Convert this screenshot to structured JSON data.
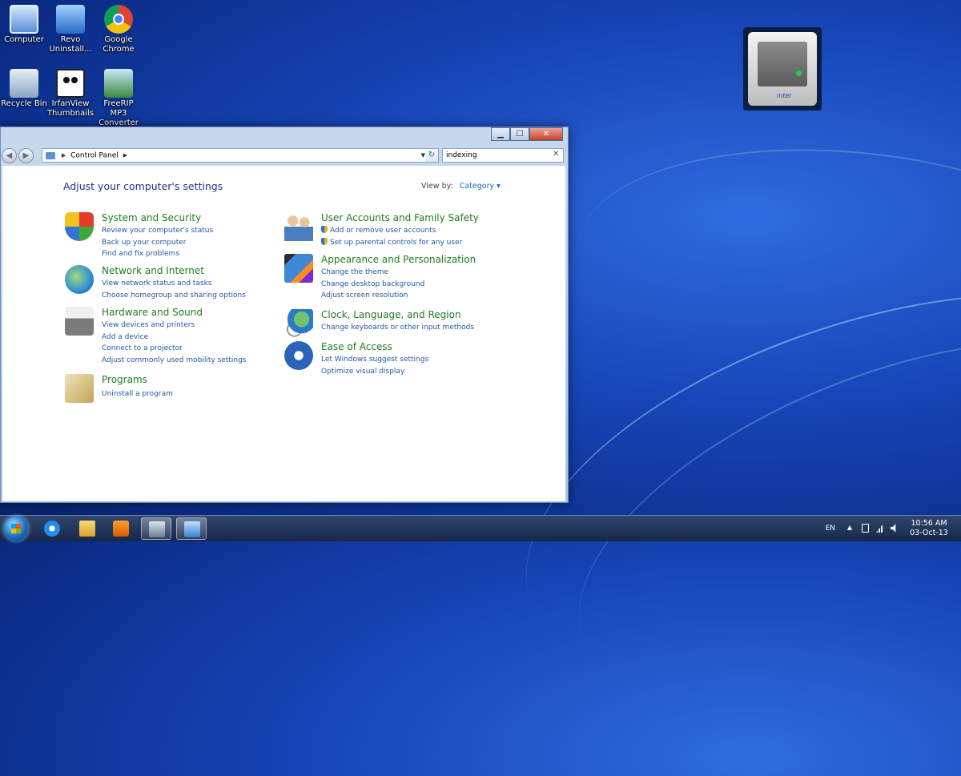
{
  "desktop": {
    "icons": [
      {
        "label": "Computer"
      },
      {
        "label": "Revo Uninstall..."
      },
      {
        "label": "Google Chrome"
      },
      {
        "label": "Recycle Bin"
      },
      {
        "label": "IrfanView Thumbnails"
      },
      {
        "label": "FreeRIP MP3 Converter"
      }
    ],
    "gadget": {
      "brand": "intel"
    }
  },
  "window": {
    "caption_buttons": {
      "minimize": "▁",
      "maximize": "☐",
      "close": "✕"
    },
    "nav": {
      "back": "◀",
      "forward": "▶"
    },
    "address": {
      "crumb": "Control Panel",
      "separator": "▶",
      "dropdown": "▼",
      "refresh": "↻"
    },
    "search": {
      "value": "indexing",
      "clear": "✕"
    },
    "title": "Adjust your computer's settings",
    "view_by": {
      "label": "View by:",
      "value": "Category ▾"
    },
    "categories_left": [
      {
        "title": "System and Security",
        "links": [
          "Review your computer's status",
          "Back up your computer",
          "Find and fix problems"
        ]
      },
      {
        "title": "Network and Internet",
        "links": [
          "View network status and tasks",
          "Choose homegroup and sharing options"
        ]
      },
      {
        "title": "Hardware and Sound",
        "links": [
          "View devices and printers",
          "Add a device",
          "Connect to a projector",
          "Adjust commonly used mobility settings"
        ]
      },
      {
        "title": "Programs",
        "links": [
          "Uninstall a program"
        ]
      }
    ],
    "categories_right": [
      {
        "title": "User Accounts and Family Safety",
        "links": [
          "Add or remove user accounts",
          "Set up parental controls for any user"
        ]
      },
      {
        "title": "Appearance and Personalization",
        "links": [
          "Change the theme",
          "Change desktop background",
          "Adjust screen resolution"
        ]
      },
      {
        "title": "Clock, Language, and Region",
        "links": [
          "Change keyboards or other input methods"
        ]
      },
      {
        "title": "Ease of Access",
        "links": [
          "Let Windows suggest settings",
          "Optimize visual display"
        ]
      }
    ]
  },
  "taskbar": {
    "language": "EN",
    "tray_expand": "▲",
    "time": "10:56 AM",
    "date": "03-Oct-13"
  }
}
